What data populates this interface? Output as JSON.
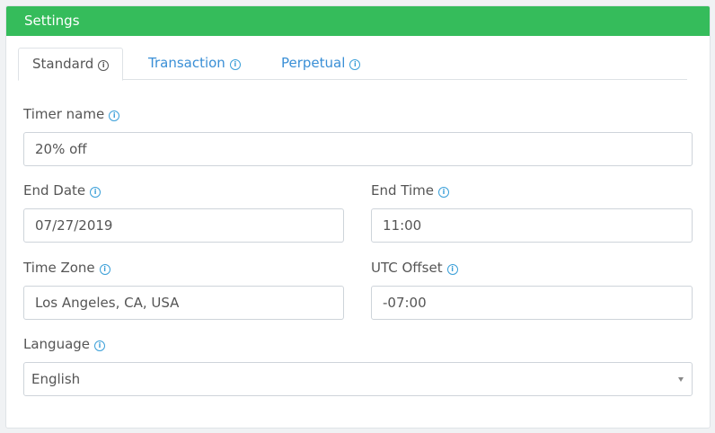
{
  "panel": {
    "title": "Settings"
  },
  "tabs": [
    {
      "label": "Standard",
      "active": true
    },
    {
      "label": "Transaction",
      "active": false
    },
    {
      "label": "Perpetual",
      "active": false
    }
  ],
  "form": {
    "timer_name": {
      "label": "Timer name",
      "value": "20% off"
    },
    "end_date": {
      "label": "End Date",
      "value": "07/27/2019"
    },
    "end_time": {
      "label": "End Time",
      "value": "11:00"
    },
    "time_zone": {
      "label": "Time Zone",
      "value": "Los Angeles, CA, USA"
    },
    "utc_offset": {
      "label": "UTC Offset",
      "value": "-07:00"
    },
    "language": {
      "label": "Language",
      "selected": "English"
    }
  },
  "icons": {
    "info": "info-circle-icon"
  },
  "colors": {
    "header": "#35bc5b",
    "link": "#3a8fd6",
    "info": "#3a9fd8"
  }
}
